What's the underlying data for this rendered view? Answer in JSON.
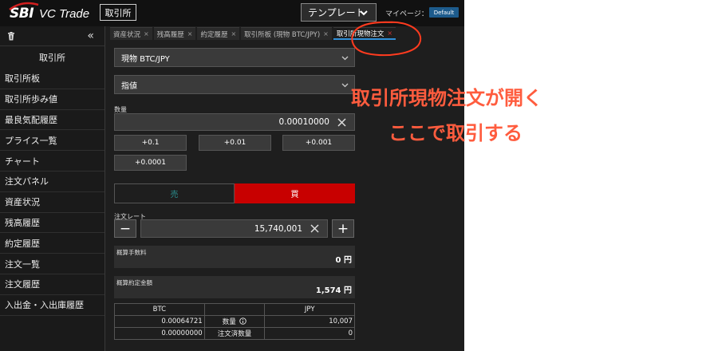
{
  "header": {
    "logo_mark": "SBI",
    "logo_text": "VC Trade",
    "exchange_button": "取引所",
    "template_button": "テンプレート",
    "mypage_label": "マイページ：",
    "default_badge": "Default"
  },
  "sidebar": {
    "title": "取引所",
    "items": [
      {
        "label": "取引所板"
      },
      {
        "label": "取引所歩み値"
      },
      {
        "label": "最良気配履歴"
      },
      {
        "label": "プライス一覧"
      },
      {
        "label": "チャート"
      },
      {
        "label": "注文パネル"
      },
      {
        "label": "資産状況"
      },
      {
        "label": "残高履歴"
      },
      {
        "label": "約定履歴"
      },
      {
        "label": "注文一覧"
      },
      {
        "label": "注文履歴"
      },
      {
        "label": "入出金・入出庫履歴"
      }
    ]
  },
  "tabs": [
    {
      "label": "資産状況",
      "close": "×"
    },
    {
      "label": "残高履歴",
      "close": "×"
    },
    {
      "label": "約定履歴",
      "close": "×"
    },
    {
      "label": "取引所板 (現物 BTC/JPY)",
      "close": "×"
    },
    {
      "label": "取引所現物注文",
      "close": "×",
      "active": true
    }
  ],
  "order": {
    "pair_select": "現物 BTC/JPY",
    "order_type_select": "指値",
    "quantity_label": "数量",
    "quantity_value": "0.00010000",
    "increments": [
      "+0.1",
      "+0.01",
      "+0.001",
      "+0.0001"
    ],
    "sell_label": "売",
    "buy_label": "買",
    "rate_label": "注文レート",
    "rate_value": "15,740,001",
    "minus": "−",
    "plus": "+",
    "fee_label": "概算手数料",
    "fee_value": "0 円",
    "amount_label": "概算約定金額",
    "amount_value": "1,574 円"
  },
  "summary": {
    "head_left": "BTC",
    "head_right": "JPY",
    "rows": [
      {
        "btc": "0.00064721",
        "label": "数量",
        "jpy": "10,007"
      },
      {
        "btc": "0.00000000",
        "label": "注文済数量",
        "jpy": "0"
      }
    ]
  },
  "annotation": {
    "line1": "取引所現物注文が開く",
    "line2": "ここで取引する",
    "color": "#ff5c3e"
  },
  "colors": {
    "buy": "#c80000",
    "sell_text": "#2a8f8f",
    "active_tab_underline": "#2f8fd8",
    "default_badge": "#1d5b8c"
  }
}
